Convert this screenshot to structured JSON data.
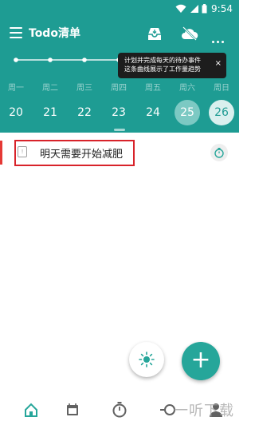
{
  "statusbar": {
    "time": "9:54"
  },
  "toolbar": {
    "title": "Todo清单"
  },
  "tooltip": {
    "line1": "计划并完成每天的待办事件",
    "line2": "这条曲线展示了工作量趋势",
    "close_glyph": "×"
  },
  "weekdays": [
    "周一",
    "周二",
    "周三",
    "周四",
    "周五",
    "周六",
    "周日"
  ],
  "dates": [
    "20",
    "21",
    "22",
    "23",
    "24",
    "25",
    "26"
  ],
  "selected_date": "25",
  "today_date": "26",
  "todos": [
    {
      "text": "明天需要开始减肥",
      "checkbox_glyph": "!"
    }
  ],
  "fab": {
    "add_glyph": "+"
  },
  "watermark": {
    "text": "一听下载"
  },
  "colors": {
    "header": "#1e9c93",
    "accent": "#26a69a",
    "highlight_border": "#d8232a",
    "priority_bar": "#e53935"
  },
  "icons": {
    "statusbar": [
      "wifi-icon",
      "signal-icon",
      "battery-icon"
    ],
    "toolbar": [
      "menu-icon",
      "inbox-icon",
      "cloud-off-icon",
      "more-icon"
    ],
    "bottom_nav": [
      "home-icon",
      "calendar-icon",
      "focus-timer-icon",
      "search-icon",
      "profile-icon"
    ]
  }
}
